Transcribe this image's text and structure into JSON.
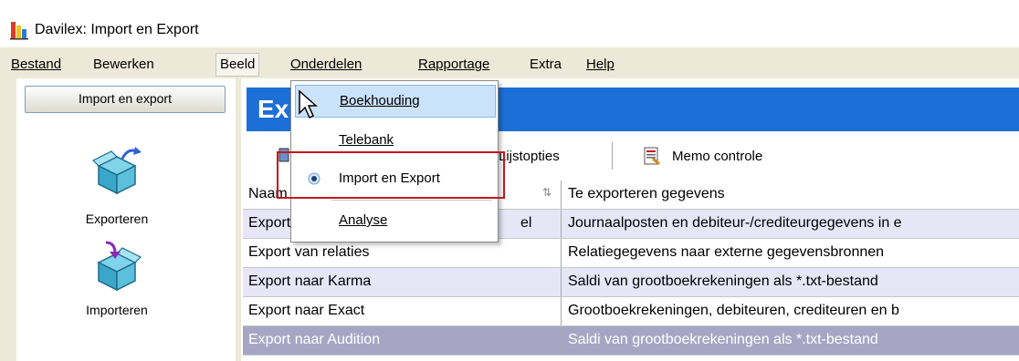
{
  "window": {
    "title": "Davilex: Import en Export",
    "app_icon": "davilex-app-icon"
  },
  "menubar": {
    "items": [
      "Bestand",
      "Bewerken",
      "Beeld",
      "Onderdelen",
      "Rapportage",
      "Extra",
      "Help"
    ],
    "active": "Beeld"
  },
  "dropdown": {
    "items": [
      "Boekhouding",
      "Telebank",
      "Import en Export",
      "Analyse"
    ],
    "hovered": "Boekhouding",
    "selected": "Import en Export"
  },
  "leftpanel": {
    "header_button": "Import en export",
    "icons": [
      {
        "label": "Exporteren",
        "icon": "export-box-icon"
      },
      {
        "label": "Importeren",
        "icon": "import-box-icon"
      }
    ]
  },
  "main": {
    "header_title": "Ex",
    "toolbar": [
      "Lijstopties",
      "Memo controle"
    ]
  },
  "grid": {
    "columns": [
      "Naam",
      "Te exporteren gegevens"
    ],
    "rows": [
      [
        "Export",
        "Journaalposten en debiteur-/crediteurgegevens in e"
      ],
      [
        "Export van relaties",
        "Relatiegegevens naar externe gegevensbronnen"
      ],
      [
        "Export naar Karma",
        "Saldi van grootboekrekeningen als *.txt-bestand"
      ],
      [
        "Export naar Exact",
        "Grootboekrekeningen, debiteuren, crediteuren en b"
      ],
      [
        "Export naar Audition",
        "Saldi van grootboekrekeningen als *.txt-bestand"
      ]
    ],
    "row_partial_suffix": "el",
    "selected_row": "Export naar Audition"
  },
  "colors": {
    "header_blue": "#1c6fd6",
    "row_alt": "#e6e6f7",
    "row_selected": "#a6a6c4",
    "highlight_box": "#c4161c",
    "menu_hover": "#cbe2fb"
  }
}
